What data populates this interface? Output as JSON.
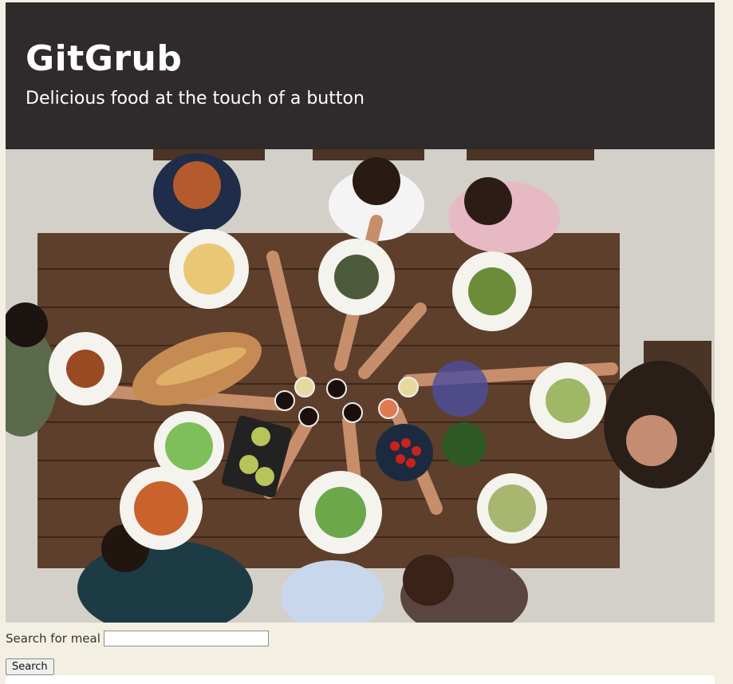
{
  "header": {
    "title": "GitGrub",
    "tagline": "Delicious food at the touch of a button"
  },
  "hero": {
    "image": "friends-toasting-around-dinner-table-photo"
  },
  "search": {
    "label": "Search for meal",
    "value": "",
    "placeholder": "",
    "button_label": "Search"
  },
  "colors": {
    "background": "#f3efe2",
    "header_bg": "#2f2a2b",
    "header_text": "#ffffff"
  }
}
